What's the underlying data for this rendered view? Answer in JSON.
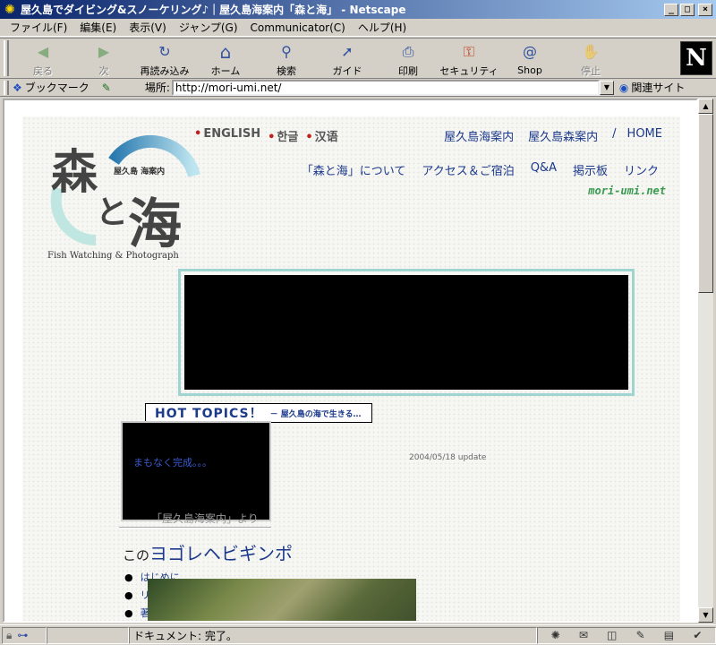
{
  "window": {
    "title": "屋久島でダイビング&スノーケリング♪｜屋久島海案内「森と海」 - Netscape",
    "controls": [
      "_",
      "□",
      "×"
    ]
  },
  "menubar": {
    "items": [
      "ファイル(F)",
      "編集(E)",
      "表示(V)",
      "ジャンプ(G)",
      "Communicator(C)",
      "ヘルプ(H)"
    ]
  },
  "toolbar": {
    "buttons": [
      {
        "label": "戻る",
        "icon": "back-icon",
        "glyph": "◀"
      },
      {
        "label": "次",
        "icon": "forward-icon",
        "glyph": "▶"
      },
      {
        "label": "再読み込み",
        "icon": "reload-icon",
        "glyph": "↻"
      },
      {
        "label": "ホーム",
        "icon": "home-icon",
        "glyph": "⌂"
      },
      {
        "label": "検索",
        "icon": "search-icon",
        "glyph": "⚲"
      },
      {
        "label": "ガイド",
        "icon": "guide-icon",
        "glyph": "➚"
      },
      {
        "label": "印刷",
        "icon": "print-icon",
        "glyph": "⎙"
      },
      {
        "label": "セキュリティ",
        "icon": "lock-icon",
        "glyph": "⚿"
      },
      {
        "label": "Shop",
        "icon": "shop-icon",
        "glyph": "@"
      },
      {
        "label": "停止",
        "icon": "stop-icon",
        "glyph": "✋"
      }
    ],
    "logo": "N"
  },
  "locationbar": {
    "bookmarks_label": "ブックマーク",
    "location_label": "場所:",
    "url": "http://mori-umi.net/",
    "related_label": "関連サイト"
  },
  "page": {
    "logo": {
      "char1": "森",
      "char2": "と",
      "char3": "海",
      "subtitle": "屋久島 海案内",
      "tagline": "Fish Watching & Photograph"
    },
    "languages": [
      "ENGLISH",
      "한글",
      "汉语"
    ],
    "top_nav": [
      "屋久島海案内",
      "屋久島森案内",
      "/",
      "HOME"
    ],
    "main_nav": [
      "「森と海」について",
      "アクセス＆ご宿泊",
      "Q&A",
      "掲示板",
      "リンク"
    ],
    "domain": "mori-umi.net",
    "hot_topics": {
      "title": "HOT TOPICS！",
      "subtitle": "－ 屋久島の海で生きる…"
    },
    "coming_soon": "まもなく完成。。。",
    "black_caption": "「屋久島海案内」より",
    "update": "2004/05/18 update",
    "section_prefix": "この",
    "section_title": "ヨゴレヘビギンポ",
    "bullets": [
      "はじめに",
      "リ",
      "著"
    ]
  },
  "statusbar": {
    "message": "ドキュメント: 完了。"
  }
}
